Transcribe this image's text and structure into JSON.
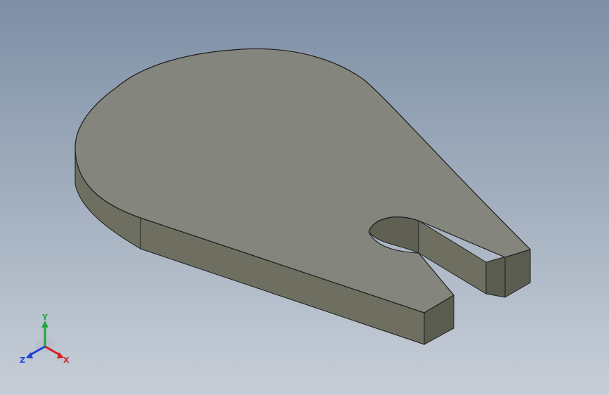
{
  "viewport": {
    "background_top": "#7e8fa5",
    "background_bottom": "#c7ced8"
  },
  "model": {
    "top_face_color": "#84857c",
    "side_face_color": "#6e6f60",
    "end_face_color": "#5b5c50",
    "edge_color": "#1e1e1e"
  },
  "triad": {
    "x_label": "X",
    "y_label": "Y",
    "z_label": "Z",
    "x_color": "#d81e1e",
    "y_color": "#1fa83a",
    "z_color": "#1f3fd0"
  }
}
